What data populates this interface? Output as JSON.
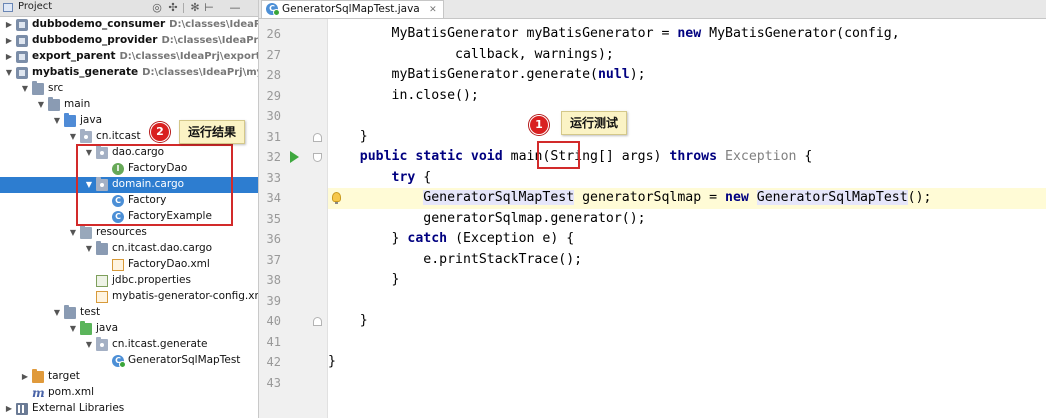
{
  "project": {
    "header_label": "Project",
    "tree": [
      {
        "label": "dubbodemo_consumer",
        "path": "D:\\classes\\IdeaPrj\\dubbo",
        "bold": true,
        "icon": "module-icon",
        "arrow": "▶"
      },
      {
        "label": "dubbodemo_provider",
        "path": "D:\\classes\\IdeaPrj\\dubb",
        "bold": true,
        "icon": "module-icon",
        "arrow": "▶"
      },
      {
        "label": "export_parent",
        "path": "D:\\classes\\IdeaPrj\\export_pare",
        "bold": true,
        "icon": "module-icon",
        "arrow": "▶"
      },
      {
        "label": "mybatis_generate",
        "path": "D:\\classes\\IdeaPrj\\mybatis_",
        "bold": true,
        "icon": "module-icon",
        "arrow": "▼"
      },
      {
        "label": "src",
        "icon": "folder-icon",
        "arrow": "▼"
      },
      {
        "label": "main",
        "icon": "folder-icon",
        "arrow": "▼"
      },
      {
        "label": "java",
        "icon": "source-folder-icon",
        "arrow": "▼"
      },
      {
        "label": "cn.itcast",
        "icon": "package-icon",
        "arrow": "▼"
      },
      {
        "label": "dao.cargo",
        "icon": "package-icon",
        "arrow": "▼"
      },
      {
        "label": "FactoryDao",
        "icon": "interface-icon",
        "icon_text": "I"
      },
      {
        "label": "domain.cargo",
        "icon": "package-icon",
        "arrow": "▼",
        "selected": true
      },
      {
        "label": "Factory",
        "icon": "class-icon",
        "icon_text": "C"
      },
      {
        "label": "FactoryExample",
        "icon": "class-icon",
        "icon_text": "C"
      },
      {
        "label": "resources",
        "icon": "resources-folder-icon",
        "arrow": "▼"
      },
      {
        "label": "cn.itcast.dao.cargo",
        "icon": "folder-icon",
        "arrow": "▼"
      },
      {
        "label": "FactoryDao.xml",
        "icon": "xml-file-icon"
      },
      {
        "label": "jdbc.properties",
        "icon": "properties-file-icon"
      },
      {
        "label": "mybatis-generator-config.xml",
        "icon": "xml-file-icon"
      },
      {
        "label": "test",
        "icon": "folder-icon",
        "arrow": "▼"
      },
      {
        "label": "java",
        "icon": "test-folder-icon",
        "arrow": "▼"
      },
      {
        "label": "cn.itcast.generate",
        "icon": "package-icon",
        "arrow": "▼"
      },
      {
        "label": "GeneratorSqlMapTest",
        "icon": "runnable-class-icon",
        "icon_text": "C"
      },
      {
        "label": "target",
        "icon": "target-folder-icon",
        "arrow": "▶"
      },
      {
        "label": "pom.xml",
        "icon": "maven-pom-icon",
        "icon_text": "m"
      },
      {
        "label": "External Libraries",
        "icon": "libraries-icon",
        "arrow": "▶"
      }
    ]
  },
  "annotations": {
    "badge_1": "1",
    "label_1": "运行测试",
    "badge_2": "2",
    "label_2": "运行结果"
  },
  "editor": {
    "tab_label": "GeneratorSqlMapTest.java",
    "tab_icon_text": "C",
    "gutter_numbers": [
      "26",
      "27",
      "28",
      "29",
      "30",
      "31",
      "32",
      "33",
      "34",
      "35",
      "36",
      "37",
      "38",
      "39",
      "40",
      "41",
      "42",
      "43"
    ],
    "lines": [
      {
        "indent": "        ",
        "tokens": [
          [
            "MyBatisGenerator myBatisGenerator = ",
            ""
          ],
          [
            "new",
            "kw"
          ],
          [
            " MyBatisGenerator(config,",
            ""
          ]
        ]
      },
      {
        "indent": "                ",
        "tokens": [
          [
            "callback, warnings);",
            ""
          ]
        ]
      },
      {
        "indent": "        ",
        "tokens": [
          [
            "myBatisGenerator.generate(",
            ""
          ],
          [
            "null",
            "kw"
          ],
          [
            ");",
            ""
          ]
        ]
      },
      {
        "indent": "        ",
        "tokens": [
          [
            "in.close();",
            ""
          ]
        ]
      },
      {
        "indent": "",
        "tokens": []
      },
      {
        "indent": "    ",
        "tokens": [
          [
            "}",
            ""
          ]
        ]
      },
      {
        "indent": "    ",
        "tokens": [
          [
            "public static void",
            "kw"
          ],
          [
            " main(String[] args) ",
            ""
          ],
          [
            "throws",
            "kw"
          ],
          [
            " Exception",
            "gray"
          ],
          [
            " {",
            ""
          ]
        ]
      },
      {
        "indent": "        ",
        "tokens": [
          [
            "try",
            "kw"
          ],
          [
            " {",
            ""
          ]
        ]
      },
      {
        "indent": "            ",
        "tokens": [
          [
            "GeneratorSqlMapTest",
            "hl"
          ],
          [
            " generatorSqlmap = ",
            ""
          ],
          [
            "new",
            "kw"
          ],
          [
            " ",
            ""
          ],
          [
            "GeneratorSqlMapTest",
            "hl"
          ],
          [
            "();",
            ""
          ]
        ]
      },
      {
        "indent": "            ",
        "tokens": [
          [
            "generatorSqlmap.generator();",
            ""
          ]
        ]
      },
      {
        "indent": "        ",
        "tokens": [
          [
            "} ",
            ""
          ],
          [
            "catch",
            "kw"
          ],
          [
            " (Exception e) {",
            ""
          ]
        ]
      },
      {
        "indent": "            ",
        "tokens": [
          [
            "e.printStackTrace();",
            ""
          ]
        ]
      },
      {
        "indent": "        ",
        "tokens": [
          [
            "}",
            ""
          ]
        ]
      },
      {
        "indent": "",
        "tokens": []
      },
      {
        "indent": "    ",
        "tokens": [
          [
            "}",
            ""
          ]
        ]
      },
      {
        "indent": "",
        "tokens": []
      },
      {
        "indent": "",
        "tokens": [
          [
            "}",
            ""
          ]
        ]
      },
      {
        "indent": "",
        "tokens": []
      }
    ]
  },
  "colors": {
    "keyword": "#000080",
    "selection": "#2d7dd0",
    "current_line": "#fffbd6",
    "annotation_red": "#d22a2a",
    "annotation_label_bg": "#fbf3c5"
  }
}
